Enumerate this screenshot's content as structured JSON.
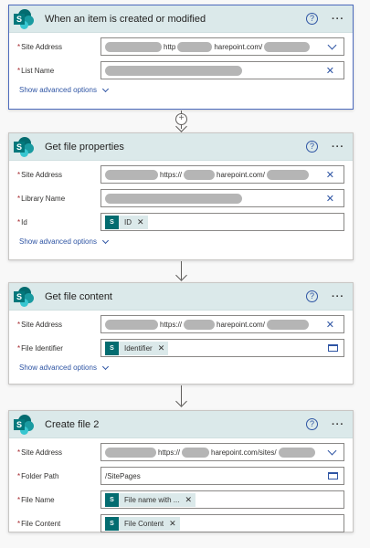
{
  "cards": [
    {
      "title": "When an item is created or modified",
      "rows": [
        {
          "label": "Site Address",
          "url": "http",
          "url2": "harepoint.com/"
        },
        {
          "label": "List Name"
        }
      ],
      "advanced": "Show advanced options"
    },
    {
      "title": "Get file properties",
      "rows": [
        {
          "label": "Site Address",
          "url": "https://",
          "url2": "harepoint.com/"
        },
        {
          "label": "Library Name"
        },
        {
          "label": "Id",
          "token": "ID"
        }
      ],
      "advanced": "Show advanced options"
    },
    {
      "title": "Get file content",
      "rows": [
        {
          "label": "Site Address",
          "url": "https://",
          "url2": "harepoint.com/"
        },
        {
          "label": "File Identifier",
          "token": "Identifier"
        }
      ],
      "advanced": "Show advanced options"
    },
    {
      "title": "Create file 2",
      "rows": [
        {
          "label": "Site Address",
          "url": "https://",
          "url2": "harepoint.com/sites/"
        },
        {
          "label": "Folder Path",
          "value": "/SitePages"
        },
        {
          "label": "File Name",
          "token": "File name with ..."
        },
        {
          "label": "File Content",
          "token": "File Content"
        }
      ]
    }
  ],
  "icons": {
    "help": "?",
    "more": "···",
    "clear": "✕",
    "add": "+",
    "logo_letter": "S"
  },
  "colors": {
    "header_bg": "#dbe9ea",
    "accent": "#2f55a4",
    "required": "#a4262c",
    "brand": "#036c70"
  }
}
